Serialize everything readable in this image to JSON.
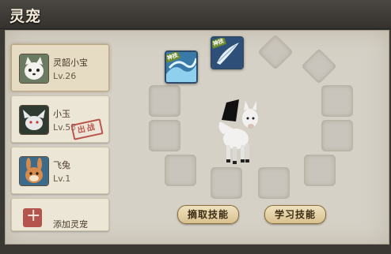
{
  "window": {
    "title": "灵宠"
  },
  "pets": [
    {
      "name": "灵韶小宝",
      "level": "Lv.26",
      "selected": true,
      "avatar_icon": "white-fox-avatar-icon"
    },
    {
      "name": "小玉",
      "level": "Lv.53",
      "status": "出战",
      "avatar_icon": "white-fox-spirit-avatar-icon"
    },
    {
      "name": "飞兔",
      "level": "Lv.1",
      "avatar_icon": "rabbit-avatar-icon"
    },
    {
      "name": "添加灵宠",
      "avatar_icon": "plus-icon"
    }
  ],
  "skills": [
    {
      "name": "water-wave-skill-icon",
      "tag": "神技"
    },
    {
      "name": "feather-wind-skill-icon",
      "tag": "神技"
    }
  ],
  "buttons": {
    "extract": "摘取技能",
    "learn": "学习技能"
  },
  "colors": {
    "panel": "#d6d1c6",
    "stamp": "#b6463e",
    "button": "#d8c18f"
  }
}
